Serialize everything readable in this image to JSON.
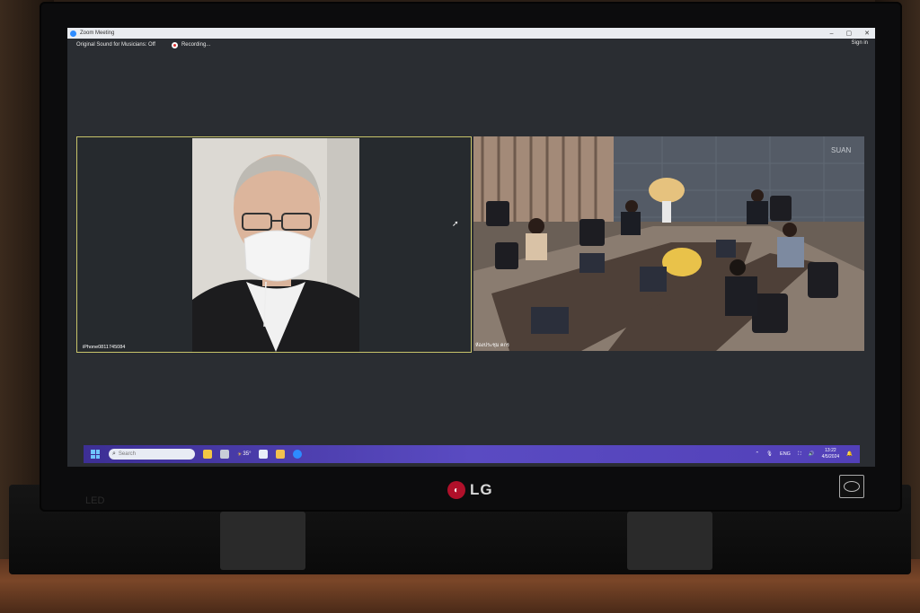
{
  "window": {
    "title": "Zoom Meeting",
    "controls": [
      "–",
      "▢",
      "✕"
    ]
  },
  "topbar": {
    "original_sound": "Original Sound for Musicians: Off",
    "recording": "Recording...",
    "sign_in": "Sign in"
  },
  "participants": {
    "left_name": "iPhone0811745084",
    "right_name": "ห้องประชุม คกร"
  },
  "room_sign": "SUAN",
  "taskbar": {
    "search_placeholder": "Search",
    "weather": "35°",
    "language": "ENG",
    "time": "13:22",
    "date": "4/5/2024"
  },
  "monitor": {
    "brand": "LG",
    "model_label": "LED"
  },
  "colors": {
    "zoom_blue": "#2d8cff",
    "taskbar": "#4a3cb0",
    "lg_red": "#b0102a",
    "active_speaker_border": "#c8c46a"
  }
}
